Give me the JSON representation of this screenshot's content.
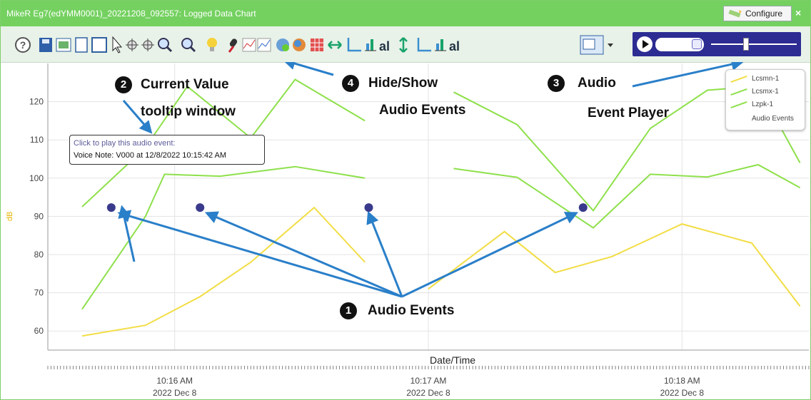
{
  "window": {
    "title": "MikeR Eg7(edYMM0001)_20221208_092557: Logged Data Chart",
    "configure_label": "Configure",
    "close_label": "×"
  },
  "toolbar": {
    "icons": [
      "help-icon",
      "save-icon",
      "image-icon",
      "new-page-icon",
      "window-icon",
      "pointer-icon",
      "pan-icon",
      "move-icon",
      "zoom-in-icon",
      "zoom-out-icon",
      "lightbulb-icon",
      "microphone-icon",
      "line-chart-icon",
      "line-chart-alt-icon",
      "globe-refresh-icon",
      "globe-icon",
      "grid-icon",
      "horizontal-arrows-icon",
      "axis-icon",
      "bar-chart-icon",
      "text-chart-icon",
      "vertical-arrows-icon",
      "axis-alt-icon",
      "bar-chart-alt-icon",
      "text-chart-alt-icon",
      "chart-settings-icon"
    ]
  },
  "player": {
    "selected_value": "",
    "volume": 0.4
  },
  "legend": {
    "items": [
      {
        "label": "Lcsmn-1",
        "color": "#f2dd44"
      },
      {
        "label": "Lcsmx-1",
        "color": "#8ee04b"
      },
      {
        "label": "Lzpk-1",
        "color": "#8ee04b"
      },
      {
        "label": "Audio Events",
        "color": ""
      }
    ]
  },
  "tooltip": {
    "line1": "Click to play this audio event:",
    "line2": "Voice Note: V000 at 12/8/2022 10:15:42 AM"
  },
  "callouts": {
    "c1": {
      "num": "1",
      "text": "Audio Events"
    },
    "c2": {
      "num": "2",
      "text_line1": "Current Value",
      "text_line2": "tooltip window"
    },
    "c3": {
      "num": "3",
      "text_line1": "Audio",
      "text_line2": "Event Player"
    },
    "c4": {
      "num": "4",
      "text_line1": "Hide/Show",
      "text_line2": "Audio Events"
    }
  },
  "colors": {
    "titlebar": "#74d160",
    "lcsmn": "#f2dd44",
    "lcsmx": "#8ee04b",
    "lzpk": "#8ee04b",
    "audio_event": "#3a3a8c",
    "arrow": "#2a7fc9"
  },
  "chart_data": {
    "type": "line",
    "xlabel": "Date/Time",
    "ylabel": "dB",
    "ylim": [
      55,
      130
    ],
    "xlim": [
      0,
      6
    ],
    "x_unit": "minutes after 10:15 AM",
    "y_ticks": [
      60,
      70,
      80,
      90,
      100,
      110,
      120
    ],
    "x_ticks": [
      {
        "x": 1,
        "time": "10:16 AM",
        "date": "2022 Dec 8"
      },
      {
        "x": 3,
        "time": "10:17 AM",
        "date": "2022 Dec 8"
      },
      {
        "x": 5,
        "time": "10:18 AM",
        "date": "2022 Dec 8"
      }
    ],
    "series": [
      {
        "name": "Lcsmn-1",
        "segments": [
          [
            [
              0.27,
              58.7
            ],
            [
              0.77,
              61.5
            ],
            [
              1.2,
              69
            ],
            [
              1.6,
              78
            ],
            [
              2.1,
              92.3
            ],
            [
              2.5,
              78
            ]
          ],
          [
            [
              3.0,
              71
            ],
            [
              3.6,
              86
            ],
            [
              4.0,
              75.3
            ],
            [
              4.45,
              79.5
            ],
            [
              5.0,
              88
            ],
            [
              5.55,
              83
            ],
            [
              5.93,
              66.5
            ]
          ]
        ]
      },
      {
        "name": "Lcsmx-1",
        "segments": [
          [
            [
              0.27,
              65.7
            ],
            [
              0.77,
              90
            ],
            [
              0.92,
              101
            ],
            [
              1.36,
              100.5
            ],
            [
              1.95,
              103
            ],
            [
              2.5,
              100
            ]
          ],
          [
            [
              3.2,
              102.5
            ],
            [
              3.7,
              100.2
            ],
            [
              4.3,
              87
            ],
            [
              4.75,
              101
            ],
            [
              5.2,
              100.3
            ],
            [
              5.6,
              103.5
            ],
            [
              5.93,
              97.5
            ]
          ]
        ]
      },
      {
        "name": "Lzpk-1",
        "segments": [
          [
            [
              0.27,
              92.5
            ],
            [
              0.77,
              108
            ],
            [
              1.1,
              124
            ],
            [
              1.6,
              110.5
            ],
            [
              1.95,
              125.8
            ],
            [
              2.5,
              115
            ]
          ],
          [
            [
              3.2,
              122.5
            ],
            [
              3.7,
              114
            ],
            [
              4.3,
              91.5
            ],
            [
              4.75,
              113
            ],
            [
              5.2,
              123
            ],
            [
              5.6,
              124
            ],
            [
              5.93,
              104
            ]
          ]
        ]
      },
      {
        "name": "Audio Events",
        "type": "scatter",
        "points": [
          [
            0.5,
            92.3
          ],
          [
            1.2,
            92.3
          ],
          [
            2.53,
            92.3
          ],
          [
            4.22,
            92.3
          ]
        ]
      }
    ]
  }
}
